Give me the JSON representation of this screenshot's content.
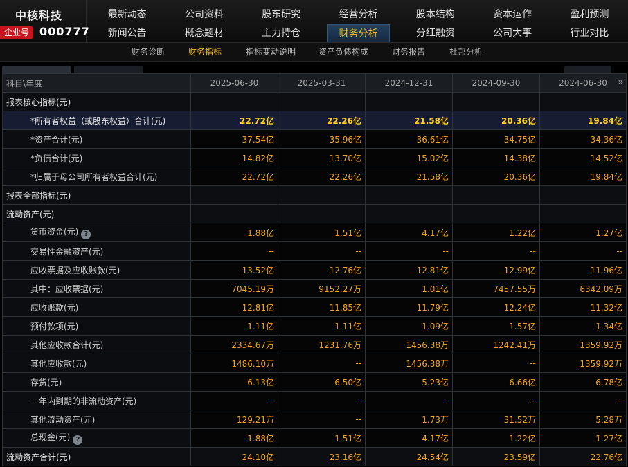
{
  "company": {
    "name": "中核科技",
    "badge": "企业号",
    "code": "000777"
  },
  "nav": {
    "row1": [
      "最新动态",
      "公司资料",
      "股东研究",
      "经营分析",
      "股本结构",
      "资本运作",
      "盈利预测"
    ],
    "row2": [
      "新闻公告",
      "概念题材",
      "主力持仓",
      "财务分析",
      "分红融资",
      "公司大事",
      "行业对比"
    ],
    "active": "财务分析"
  },
  "subnav": {
    "items": [
      "财务诊断",
      "财务指标",
      "指标变动说明",
      "资产负债构成",
      "财务报告",
      "杜邦分析"
    ],
    "active": "财务指标"
  },
  "colors": {
    "accent": "#f4c21c",
    "value": "#f4a51c",
    "badge": "#c8141d",
    "highlight_row": "#161d33"
  },
  "table": {
    "header_label": "科目\\年度",
    "periods": [
      "2025-06-30",
      "2025-03-31",
      "2024-12-31",
      "2024-09-30",
      "2024-06-30"
    ],
    "more_icon": "double-chevron-right-icon",
    "rows": [
      {
        "label": "报表核心指标(元)",
        "type": "section",
        "values": [
          "",
          "",
          "",
          "",
          ""
        ]
      },
      {
        "label": "*所有者权益（或股东权益）合计(元)",
        "type": "highlight",
        "values": [
          "22.72亿",
          "22.26亿",
          "21.58亿",
          "20.36亿",
          "19.84亿"
        ]
      },
      {
        "label": "*资产合计(元)",
        "type": "item",
        "values": [
          "37.54亿",
          "35.96亿",
          "36.61亿",
          "34.75亿",
          "34.36亿"
        ]
      },
      {
        "label": "*负债合计(元)",
        "type": "item",
        "values": [
          "14.82亿",
          "13.70亿",
          "15.02亿",
          "14.38亿",
          "14.52亿"
        ]
      },
      {
        "label": "*归属于母公司所有者权益合计(元)",
        "type": "item",
        "values": [
          "22.72亿",
          "22.26亿",
          "21.58亿",
          "20.36亿",
          "19.84亿"
        ]
      },
      {
        "label": "报表全部指标(元)",
        "type": "section",
        "values": [
          "",
          "",
          "",
          "",
          ""
        ]
      },
      {
        "label": "流动资产(元)",
        "type": "section",
        "values": [
          "",
          "",
          "",
          "",
          ""
        ]
      },
      {
        "label": "货币资金(元)",
        "type": "sub",
        "help": true,
        "values": [
          "1.88亿",
          "1.51亿",
          "4.17亿",
          "1.22亿",
          "1.27亿"
        ]
      },
      {
        "label": "交易性金融资产(元)",
        "type": "sub",
        "values": [
          "--",
          "--",
          "--",
          "--",
          "--"
        ]
      },
      {
        "label": "应收票据及应收账款(元)",
        "type": "sub",
        "values": [
          "13.52亿",
          "12.76亿",
          "12.81亿",
          "12.99亿",
          "11.96亿"
        ]
      },
      {
        "label": "其中：应收票据(元)",
        "type": "sub",
        "values": [
          "7045.19万",
          "9152.27万",
          "1.01亿",
          "7457.55万",
          "6342.09万"
        ]
      },
      {
        "label": "应收账款(元)",
        "type": "sub",
        "values": [
          "12.81亿",
          "11.85亿",
          "11.79亿",
          "12.24亿",
          "11.32亿"
        ]
      },
      {
        "label": "预付款项(元)",
        "type": "sub",
        "values": [
          "1.11亿",
          "1.11亿",
          "1.09亿",
          "1.57亿",
          "1.34亿"
        ]
      },
      {
        "label": "其他应收款合计(元)",
        "type": "sub",
        "values": [
          "2334.67万",
          "1231.76万",
          "1456.38万",
          "1242.41万",
          "1359.92万"
        ]
      },
      {
        "label": "其他应收款(元)",
        "type": "sub",
        "values": [
          "1486.10万",
          "--",
          "1456.38万",
          "--",
          "1359.92万"
        ]
      },
      {
        "label": "存货(元)",
        "type": "sub",
        "values": [
          "6.13亿",
          "6.50亿",
          "5.23亿",
          "6.66亿",
          "6.78亿"
        ]
      },
      {
        "label": "一年内到期的非流动资产(元)",
        "type": "sub",
        "values": [
          "--",
          "--",
          "--",
          "--",
          "--"
        ]
      },
      {
        "label": "其他流动资产(元)",
        "type": "sub",
        "values": [
          "129.21万",
          "--",
          "1.73万",
          "31.52万",
          "5.28万"
        ]
      },
      {
        "label": "总现金(元)",
        "type": "sub",
        "help": true,
        "values": [
          "1.88亿",
          "1.51亿",
          "4.17亿",
          "1.22亿",
          "1.27亿"
        ]
      },
      {
        "label": "流动资产合计(元)",
        "type": "section",
        "values": [
          "24.10亿",
          "23.16亿",
          "24.54亿",
          "23.59亿",
          "22.76亿"
        ]
      }
    ]
  }
}
